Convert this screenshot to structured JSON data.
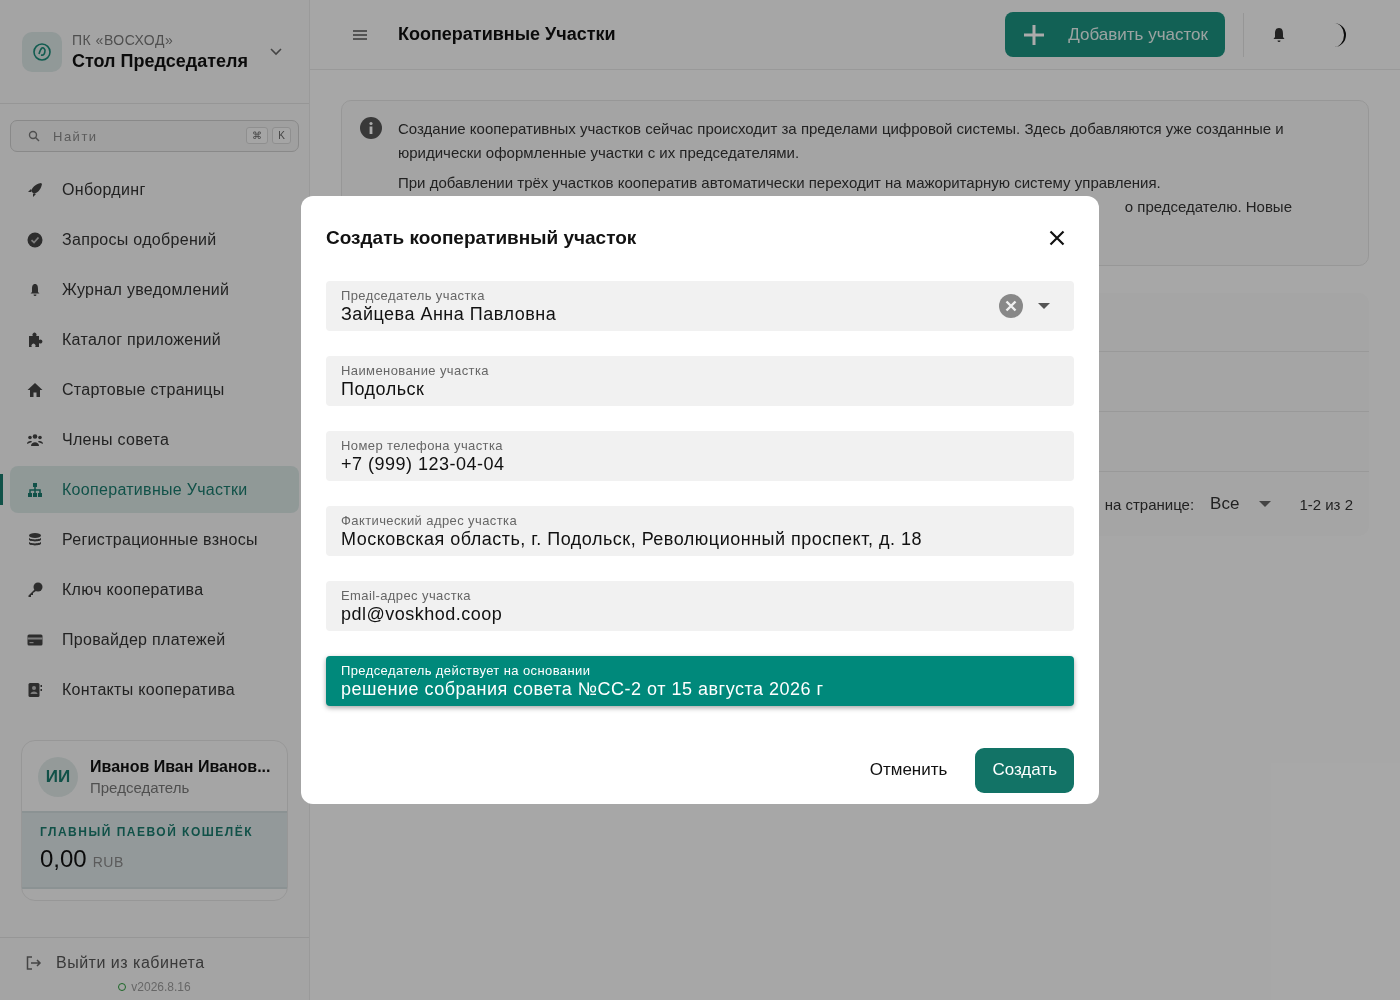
{
  "sidebar": {
    "org": "ПК «ВОСХОД»",
    "title": "Стол Председателя",
    "search": {
      "placeholder": "Найти",
      "keys": [
        "⌘",
        "K"
      ]
    },
    "items": [
      {
        "label": "Онбординг",
        "selected": false
      },
      {
        "label": "Запросы одобрений",
        "selected": false
      },
      {
        "label": "Журнал уведомлений",
        "selected": false
      },
      {
        "label": "Каталог приложений",
        "selected": false
      },
      {
        "label": "Стартовые страницы",
        "selected": false
      },
      {
        "label": "Члены совета",
        "selected": false
      },
      {
        "label": "Кооперативные Участки",
        "selected": true
      },
      {
        "label": "Регистрационные взносы",
        "selected": false
      },
      {
        "label": "Ключ кооператива",
        "selected": false
      },
      {
        "label": "Провайдер платежей",
        "selected": false
      },
      {
        "label": "Контакты кооператива",
        "selected": false
      }
    ],
    "user": {
      "initials": "ИИ",
      "name": "Иванов Иван Иванов...",
      "role": "Председатель",
      "wallet_label": "ГЛАВНЫЙ ПАЕВОЙ КОШЕЛЁК",
      "amount": "0,00",
      "currency": "RUB"
    },
    "logout": "Выйти из кабинета",
    "version": "v2026.8.16"
  },
  "header": {
    "title": "Кооперативные Участки",
    "add_button": "Добавить участок"
  },
  "info": {
    "paragraph_1": "Создание кооперативных участков сейчас происходит за пределами цифровой системы. Здесь добавляются уже созданные и юридически оформленные участки с их председателями.",
    "paragraph_2_line_1": "При добавлении трёх участков кооператив автоматически переходит на мажоритарную систему управления.",
    "paragraph_2_line_2": "о председателю. Новые"
  },
  "table": {
    "rows_per_page_label": "на странице:",
    "rows_per_page": "Все",
    "range": "1-2 из 2"
  },
  "dialog": {
    "title": "Создать кооперативный участок",
    "fields": [
      {
        "kind": "select",
        "label": "Председатель участка",
        "value": "Зайцева Анна Павловна",
        "focused": false
      },
      {
        "kind": "text",
        "label": "Наименование участка",
        "value": "Подольск",
        "focused": false
      },
      {
        "kind": "text",
        "label": "Номер телефона участка",
        "value": "+7 (999) 123-04-04",
        "focused": false
      },
      {
        "kind": "text",
        "label": "Фактический адрес участка",
        "value": "Московская область, г. Подольск, Революционный проспект, д. 18",
        "focused": false
      },
      {
        "kind": "text",
        "label": "Email-адрес участка",
        "value": "pdl@voskhod.coop",
        "focused": false
      },
      {
        "kind": "text",
        "label": "Председатель действует на основании",
        "value": "решение собрания совета №СС-2 от 15 августа 2026 г",
        "focused": true
      }
    ],
    "cancel": "Отменить",
    "submit": "Создать"
  }
}
